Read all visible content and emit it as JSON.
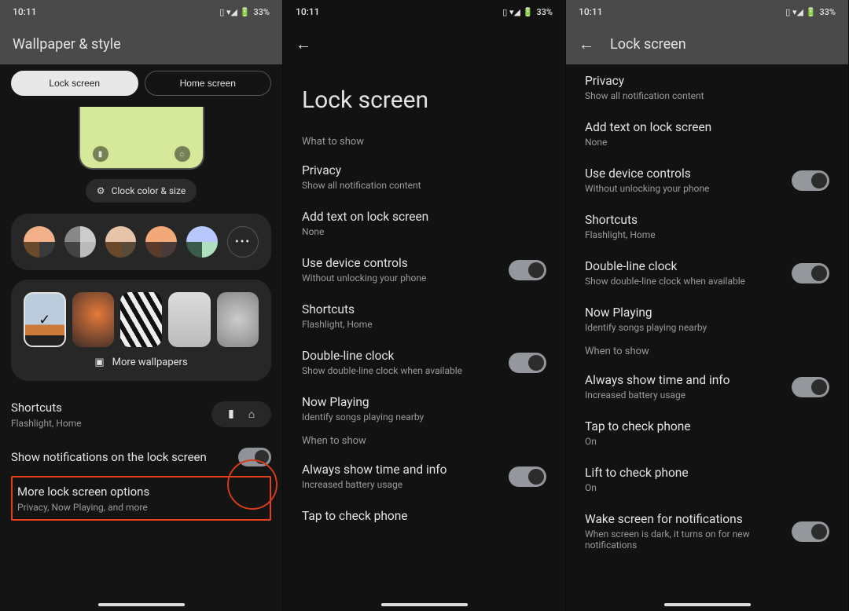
{
  "status": {
    "time": "10:11",
    "battery": "33%"
  },
  "s1": {
    "title": "Wallpaper & style",
    "tab_lock": "Lock screen",
    "tab_home": "Home screen",
    "clock_chip": "Clock color & size",
    "more_wallpapers": "More wallpapers",
    "shortcuts": {
      "title": "Shortcuts",
      "sub": "Flashlight, Home"
    },
    "notif": "Show notifications on the lock screen",
    "more": {
      "title": "More lock screen options",
      "sub": "Privacy, Now Playing, and more"
    }
  },
  "s2": {
    "title": "Lock screen",
    "section_what": "What to show",
    "section_when": "When to show",
    "items_what": [
      {
        "title": "Privacy",
        "sub": "Show all notification content",
        "toggle": null
      },
      {
        "title": "Add text on lock screen",
        "sub": "None",
        "toggle": null
      },
      {
        "title": "Use device controls",
        "sub": "Without unlocking your phone",
        "toggle": true
      },
      {
        "title": "Shortcuts",
        "sub": "Flashlight, Home",
        "toggle": null
      },
      {
        "title": "Double-line clock",
        "sub": "Show double-line clock when available",
        "toggle": true
      },
      {
        "title": "Now Playing",
        "sub": "Identify songs playing nearby",
        "toggle": null
      }
    ],
    "items_when": [
      {
        "title": "Always show time and info",
        "sub": "Increased battery usage",
        "toggle": true
      },
      {
        "title": "Tap to check phone",
        "sub": "",
        "toggle": null
      }
    ]
  },
  "s3": {
    "title": "Lock screen",
    "items_what": [
      {
        "title": "Privacy",
        "sub": "Show all notification content",
        "toggle": null
      },
      {
        "title": "Add text on lock screen",
        "sub": "None",
        "toggle": null
      },
      {
        "title": "Use device controls",
        "sub": "Without unlocking your phone",
        "toggle": true
      },
      {
        "title": "Shortcuts",
        "sub": "Flashlight, Home",
        "toggle": null
      },
      {
        "title": "Double-line clock",
        "sub": "Show double-line clock when available",
        "toggle": true
      },
      {
        "title": "Now Playing",
        "sub": "Identify songs playing nearby",
        "toggle": null
      }
    ],
    "section_when": "When to show",
    "items_when": [
      {
        "title": "Always show time and info",
        "sub": "Increased battery usage",
        "toggle": true
      },
      {
        "title": "Tap to check phone",
        "sub": "On",
        "toggle": null
      },
      {
        "title": "Lift to check phone",
        "sub": "On",
        "toggle": null
      },
      {
        "title": "Wake screen for notifications",
        "sub": "When screen is dark, it turns on for new notifications",
        "toggle": true
      }
    ]
  }
}
